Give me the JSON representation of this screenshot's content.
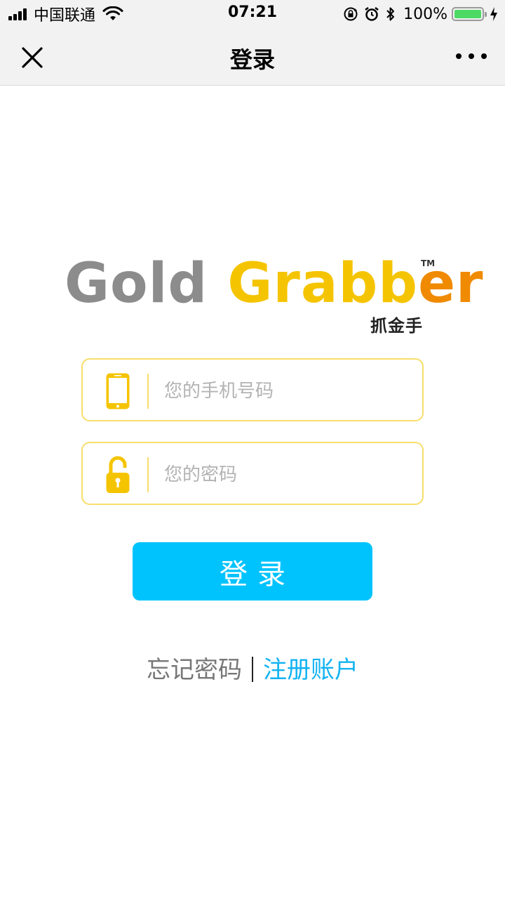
{
  "status_bar": {
    "carrier": "中国联通",
    "time": "07:21",
    "battery_percent": "100%",
    "battery_level": 1.0
  },
  "nav": {
    "title": "登录"
  },
  "logo": {
    "word1": "Gold",
    "word2_main": "Grabb",
    "word2_accent": "er",
    "tm": "TM",
    "subtitle": "抓金手"
  },
  "form": {
    "phone_placeholder": "您的手机号码",
    "phone_value": "",
    "password_placeholder": "您的密码",
    "password_value": "",
    "login_label": "登录"
  },
  "links": {
    "forgot": "忘记密码",
    "register": "注册账户"
  },
  "colors": {
    "accent_blue": "#00c3fe",
    "link_blue": "#13b3f2",
    "field_border": "#f8de6a",
    "icon_yellow": "#f5c400",
    "logo_gray": "#8c8c8c",
    "logo_orange": "#f08a00"
  }
}
